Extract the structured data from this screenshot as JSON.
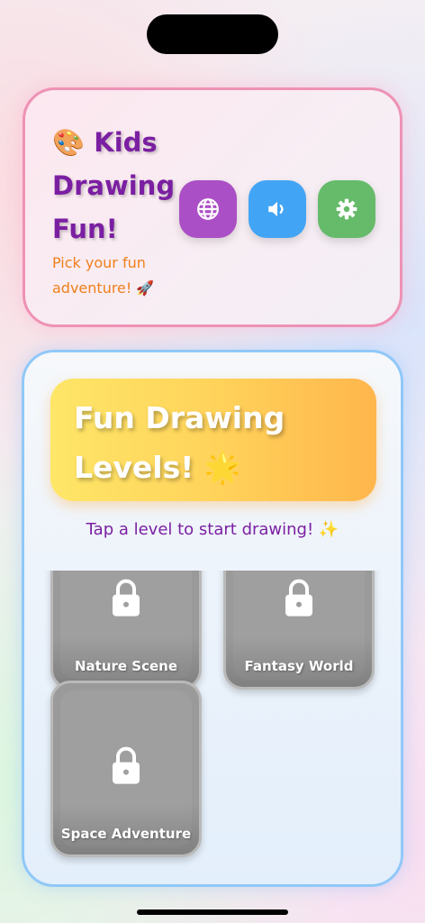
{
  "header": {
    "emoji": "🎨",
    "title": "Kids Drawing Fun!",
    "subtitle": "Pick your fun adventure! 🚀",
    "buttons": [
      {
        "name": "language",
        "icon": "globe-icon",
        "color": "#ab4fc6"
      },
      {
        "name": "sound",
        "icon": "speaker-icon",
        "color": "#42a4f4"
      },
      {
        "name": "settings",
        "icon": "gear-icon",
        "color": "#66bb6a"
      }
    ]
  },
  "levels": {
    "title": "Fun Drawing Levels!",
    "title_emoji": "🌟",
    "hint": "Tap a level to start drawing! ✨",
    "items": [
      {
        "label": "Nature Scene",
        "locked": true,
        "icon": "lock-icon"
      },
      {
        "label": "Fantasy World",
        "locked": true,
        "icon": "lock-icon"
      },
      {
        "label": "Space Adventure",
        "locked": true,
        "icon": "lock-icon"
      }
    ]
  },
  "colors": {
    "title_purple": "#7b1fa2",
    "subtitle_orange": "#f07f1b",
    "header_border": "#ee92b5",
    "panel_border": "#90c8f8",
    "locked_card": "#9a9a9a"
  }
}
